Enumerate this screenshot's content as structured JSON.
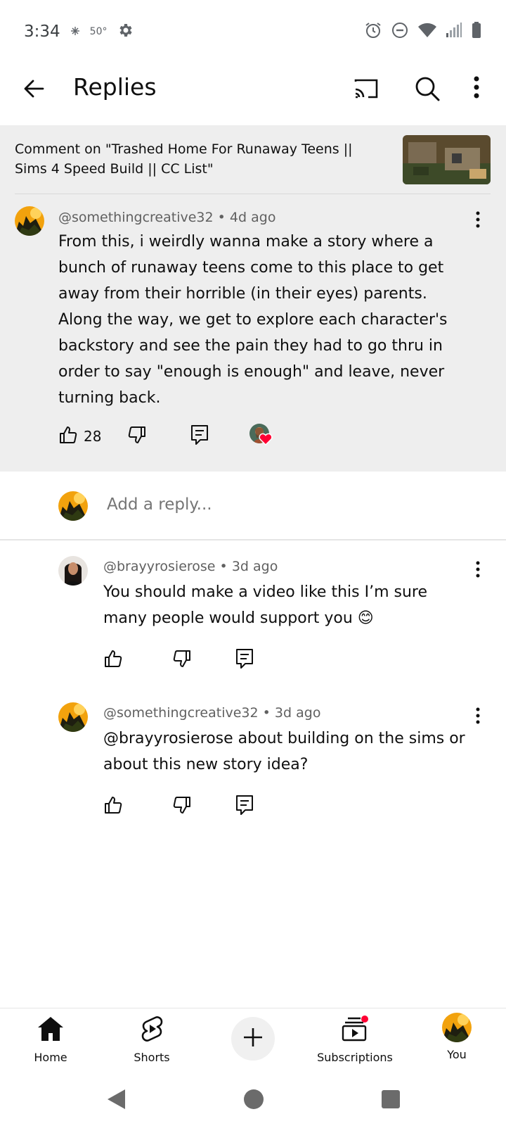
{
  "status_bar": {
    "time": "3:34",
    "temperature": "50°",
    "icons": [
      "weather-icon",
      "settings-icon",
      "alarm-icon",
      "dnd-icon",
      "wifi-icon",
      "signal-icon",
      "battery-icon"
    ]
  },
  "app_bar": {
    "title": "Replies",
    "icons": [
      "back-arrow-icon",
      "cast-icon",
      "search-icon",
      "more-vert-icon"
    ]
  },
  "context": {
    "header": "Comment on \"Trashed Home For Runaway Teens || Sims 4 Speed Build || CC List\"",
    "thumbnail_icon": "video-thumbnail"
  },
  "main_comment": {
    "author": "@somethingcreative32",
    "time": "4d ago",
    "separator": "•",
    "text": "From this, i weirdly wanna make a story where a bunch of runaway teens come to this place to get away from their horrible (in their eyes) parents. Along the way, we get to explore each character's backstory and see the pain they had to go thru in order to say \"enough is enough\" and leave, never turning back.",
    "likes": "28"
  },
  "reply_box": {
    "placeholder": "Add a reply..."
  },
  "replies": [
    {
      "author": "@brayyrosierose",
      "time": "3d ago",
      "text": "You should make a video like this I’m sure many people would support you 😊"
    },
    {
      "author": "@somethingcreative32",
      "time": "3d ago",
      "text": "@brayyrosierose  about building on the sims or about this new story idea?"
    }
  ],
  "bottom_nav": {
    "items": [
      {
        "label": "Home",
        "icon": "home-icon"
      },
      {
        "label": "Shorts",
        "icon": "shorts-icon"
      },
      {
        "label": "",
        "icon": "create-plus-icon"
      },
      {
        "label": "Subscriptions",
        "icon": "subscriptions-icon"
      },
      {
        "label": "You",
        "icon": "avatar"
      }
    ]
  },
  "colors": {
    "context_bg": "#eeeeee",
    "text_primary": "#0f0f0f",
    "text_secondary": "#606060",
    "heart": "#ff0033",
    "notification_dot": "#ff0033"
  }
}
